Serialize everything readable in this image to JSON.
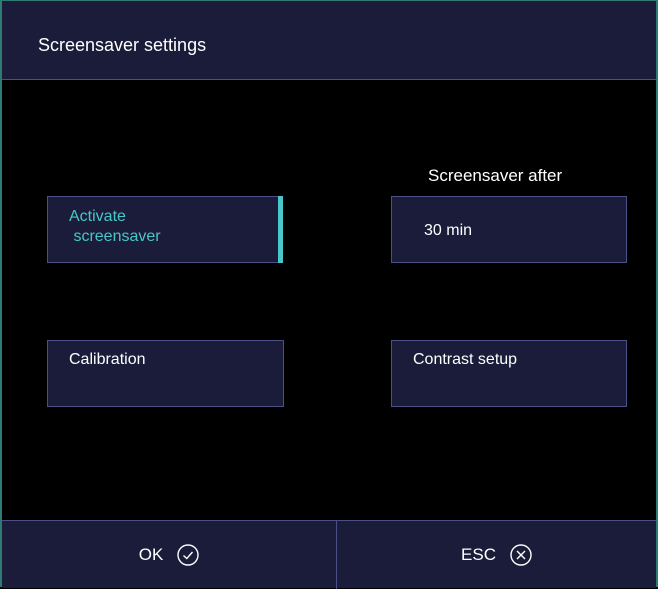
{
  "window": {
    "title": "Screensaver settings"
  },
  "screensaver_after": {
    "label": "Screensaver after",
    "value": "30 min"
  },
  "buttons": {
    "activate": "Activate\n screensaver",
    "calibration": "Calibration",
    "contrast": "Contrast setup"
  },
  "footer": {
    "ok": "OK",
    "esc": "ESC"
  },
  "colors": {
    "background": "#000000",
    "panel": "#1b1c3a",
    "border": "#4a4f86",
    "accent": "#48c6c8",
    "frame": "#2e7a74",
    "text": "#ffffff"
  },
  "icons": {
    "ok": "check-circle-icon",
    "esc": "x-circle-icon"
  }
}
